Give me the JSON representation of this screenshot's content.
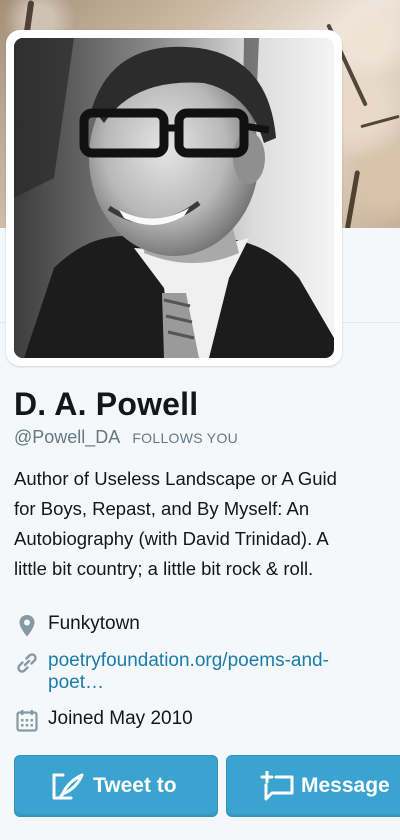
{
  "profile": {
    "name": "D. A. Powell",
    "handle": "@Powell_DA",
    "follows_you": "FOLLOWS YOU",
    "bio_lines": [
      "Author of Useless Landscape or A Guid",
      "for Boys, Repast, and By Myself: An",
      "Autobiography (with David Trinidad). A",
      "little bit country; a little bit rock & roll."
    ],
    "location": "Funkytown",
    "url_lines": [
      "poetryfoundation.org/poems-and-",
      "poet…"
    ],
    "joined": "Joined May 2010"
  },
  "icons": {
    "location": "map-pin-icon",
    "url": "link-icon",
    "joined": "calendar-icon",
    "tweet_to": "compose-tweet-icon",
    "message": "new-message-icon"
  },
  "actions": {
    "tweet_to_label": "Tweet to",
    "message_label": "Message"
  },
  "colors": {
    "link": "#1b7baa",
    "button": "#3ba3cf",
    "secondary_text": "#657786",
    "background": "#f5f8fa"
  }
}
